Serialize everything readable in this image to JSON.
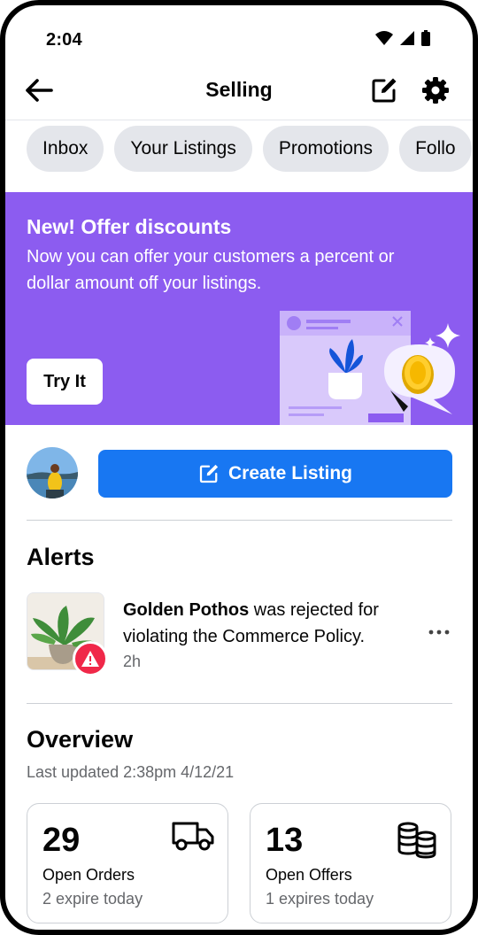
{
  "status_bar": {
    "time": "2:04"
  },
  "header": {
    "title": "Selling"
  },
  "tabs": [
    {
      "label": "Inbox"
    },
    {
      "label": "Your Listings"
    },
    {
      "label": "Promotions"
    },
    {
      "label": "Follo"
    }
  ],
  "banner": {
    "title": "New! Offer discounts",
    "text": "Now you can offer your customers a percent or dollar amount off your listings.",
    "button": "Try It",
    "color": "#8c5cf0"
  },
  "create_listing": {
    "label": "Create Listing",
    "color": "#1877f2"
  },
  "alerts": {
    "heading": "Alerts",
    "item": {
      "product": "Golden Pothos",
      "message": " was rejected for violating the Commerce Policy.",
      "time": "2h"
    }
  },
  "overview": {
    "heading": "Overview",
    "updated": "Last updated 2:38pm 4/12/21",
    "cards": [
      {
        "value": "29",
        "label": "Open Orders",
        "sub": "2 expire today",
        "icon": "truck-icon"
      },
      {
        "value": "13",
        "label": "Open Offers",
        "sub": "1 expires today",
        "icon": "coins-icon"
      }
    ]
  }
}
